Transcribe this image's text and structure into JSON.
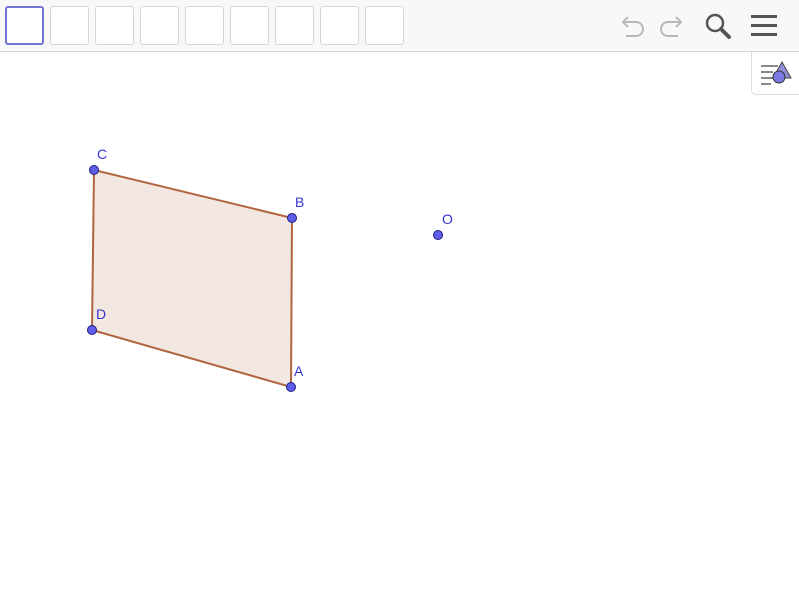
{
  "toolbar": {
    "tools": [
      {
        "name": "tool-slot-1",
        "selected": true
      },
      {
        "name": "tool-slot-2",
        "selected": false
      },
      {
        "name": "tool-slot-3",
        "selected": false
      },
      {
        "name": "tool-slot-4",
        "selected": false
      },
      {
        "name": "tool-slot-5",
        "selected": false
      },
      {
        "name": "tool-slot-6",
        "selected": false
      },
      {
        "name": "tool-slot-7",
        "selected": false
      },
      {
        "name": "tool-slot-8",
        "selected": false
      },
      {
        "name": "tool-slot-9",
        "selected": false
      }
    ],
    "icons": {
      "undo": "undo-icon",
      "redo": "redo-icon",
      "search": "search-icon",
      "menu": "menu-icon",
      "graphics": "graphics-style-icon"
    }
  },
  "canvas": {
    "points": [
      {
        "id": "C",
        "label": "C"
      },
      {
        "id": "B",
        "label": "B"
      },
      {
        "id": "D",
        "label": "D"
      },
      {
        "id": "A",
        "label": "A"
      },
      {
        "id": "O",
        "label": "O"
      }
    ],
    "polygon": {
      "vertices": [
        "A",
        "B",
        "C",
        "D"
      ]
    }
  },
  "colors": {
    "point_fill": "#5e5ee8",
    "point_stroke": "#1d1d80",
    "label": "#3535d0",
    "polygon_edge": "#b0653f",
    "polygon_fill": "#f3e7e2",
    "selected_tool": "#6f74d6",
    "icon_gray": "#b8b8b8",
    "icon_dark": "#555555"
  }
}
